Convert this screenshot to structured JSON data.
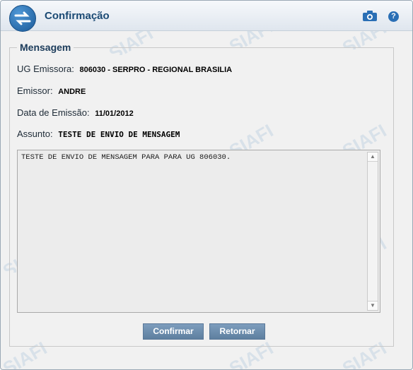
{
  "window": {
    "title": "Confirmação"
  },
  "watermark": {
    "text": "SIAFI"
  },
  "message_section": {
    "legend": "Mensagem",
    "fields": [
      {
        "label": "UG Emissora:",
        "value": "806030 - SERPRO - REGIONAL BRASILIA"
      },
      {
        "label": "Emissor:",
        "value": "ANDRE"
      },
      {
        "label": "Data de Emissão:",
        "value": "11/01/2012"
      },
      {
        "label": "Assunto:",
        "value": "TESTE DE ENVIO DE MENSAGEM"
      }
    ],
    "body_text": "TESTE DE ENVIO DE MENSAGEM PARA PARA UG 806030."
  },
  "buttons": {
    "confirm_label": "Confirmar",
    "back_label": "Retornar"
  },
  "icons": {
    "logo": "siafi-logo-icon",
    "camera": "camera-icon",
    "help": "help-icon"
  },
  "colors": {
    "title": "#1b4a74",
    "button": "#6b8aaa",
    "accent": "#2a6fb5"
  }
}
